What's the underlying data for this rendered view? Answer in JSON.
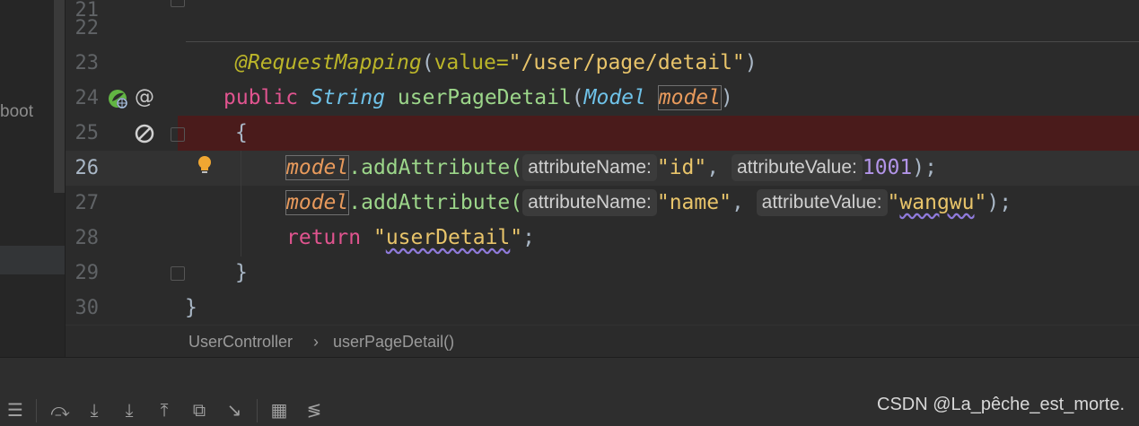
{
  "left_panel": {
    "partial_label": "boot"
  },
  "line_numbers": [
    "22",
    "23",
    "24",
    "25",
    "26",
    "27",
    "28",
    "29",
    "30"
  ],
  "current_line": "26",
  "code": {
    "line23": {
      "annotation": "@RequestMapping",
      "open": "(",
      "attr": "value=",
      "value": "\"/user/page/detail\"",
      "close": ")"
    },
    "line24": {
      "kw": "public",
      "ret_type": "String",
      "method": "userPageDetail",
      "open": "(",
      "param_type": "Model",
      "param": "model",
      "close": ")"
    },
    "line25": {
      "text": "{"
    },
    "line26": {
      "obj": "model",
      "call": ".addAttribute(",
      "hint1": "attributeName:",
      "arg1": "\"id\"",
      "comma": ",",
      "hint2": "attributeValue:",
      "arg2": "1001",
      "end": ");"
    },
    "line27": {
      "obj": "model",
      "call": ".addAttribute(",
      "hint1": "attributeName:",
      "arg1": "\"name\"",
      "comma": ",",
      "hint2": "attributeValue:",
      "arg2_q1": "\"",
      "arg2": "wangwu",
      "arg2_q2": "\"",
      "end": ");"
    },
    "line28": {
      "kw": "return",
      "q1": "\"",
      "value": "userDetail",
      "q2": "\"",
      "end": ";"
    },
    "line29": {
      "text": "}"
    },
    "line30": {
      "text": "}"
    }
  },
  "gutter_icons": {
    "line24": [
      "spring-web-icon",
      "at-sign-icon"
    ],
    "line25": [
      "breakpoint-disabled-icon"
    ],
    "line26": [
      "lightbulb-icon"
    ]
  },
  "breadcrumb": {
    "class_name": "UserController",
    "separator": "›",
    "method_name": "userPageDetail()"
  },
  "toolbar_icons": [
    "menu-icon",
    "step-over-icon",
    "step-into-icon",
    "force-step-into-icon",
    "step-out-icon",
    "drop-frame-icon",
    "run-to-cursor-icon",
    "evaluate-icon",
    "trace-icon"
  ],
  "watermark": "CSDN @La_pêche_est_morte.",
  "colors": {
    "breakpoint_row": "#4a1b1b",
    "current_row": "#323232",
    "keyword": "#e0548f",
    "string": "#e8c46a",
    "type": "#6fc2e8",
    "method": "#9cd68a",
    "param": "#e89a5c",
    "number": "#b294e8",
    "annotation": "#bbb529"
  }
}
